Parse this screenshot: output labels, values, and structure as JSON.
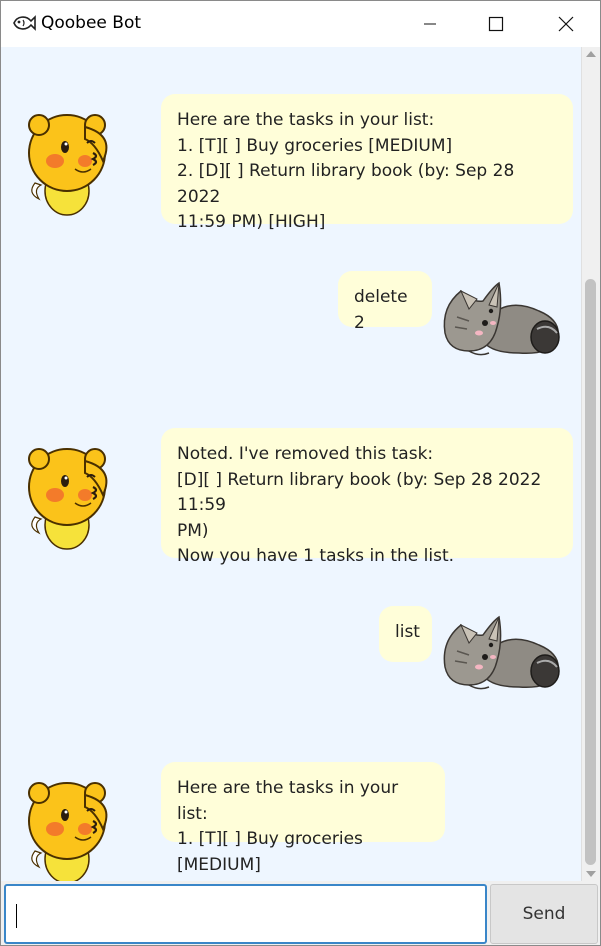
{
  "window": {
    "title": "Qoobee Bot"
  },
  "messages": [
    {
      "sender": "bot",
      "text": "Here are the tasks in your list:\n1. [T][ ] Buy groceries [MEDIUM]\n2. [D][ ] Return library book (by: Sep 28 2022\n11:59 PM) [HIGH]"
    },
    {
      "sender": "user",
      "text": "delete 2"
    },
    {
      "sender": "bot",
      "text": "Noted. I've removed this task:\n[D][ ] Return library book (by: Sep 28 2022 11:59\nPM)\nNow you have 1 tasks in the list."
    },
    {
      "sender": "user",
      "text": "list"
    },
    {
      "sender": "bot",
      "text": "Here are the tasks in your list:\n1. [T][ ] Buy groceries [MEDIUM]"
    }
  ],
  "input": {
    "value": "",
    "send_label": "Send"
  },
  "colors": {
    "chat_background": "#eef6ff",
    "bubble": "#fffed9",
    "input_focus": "#3a86c8"
  }
}
